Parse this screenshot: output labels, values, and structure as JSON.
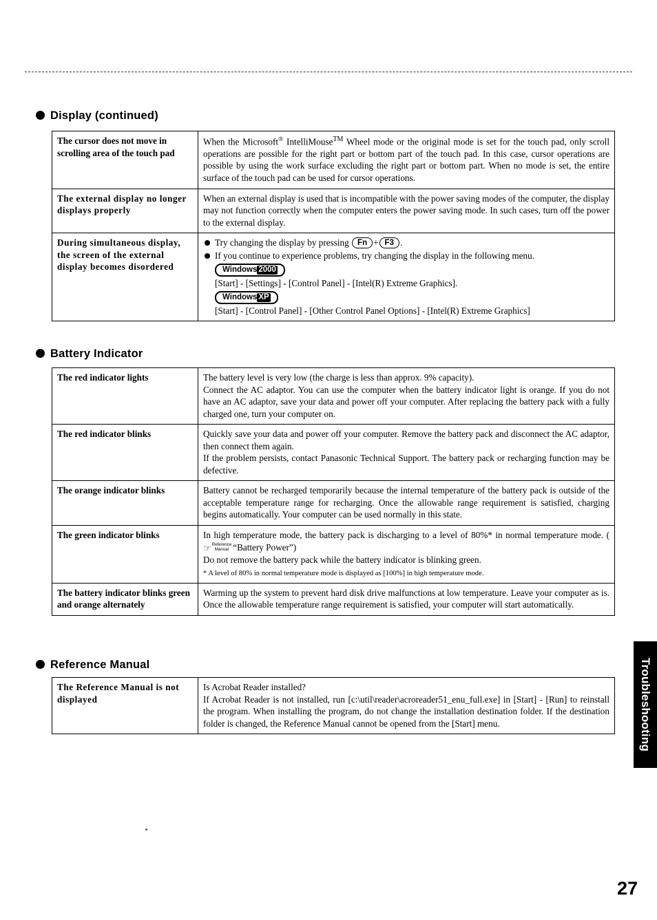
{
  "page": {
    "number": "27",
    "side_tab": "Troubleshooting"
  },
  "sections": [
    {
      "id": "display",
      "heading": "Display (continued)",
      "rows": [
        {
          "label": "The cursor does not move in scrolling area of the touch pad",
          "body": "When the Microsoft® IntelliMouse™ Wheel mode or the original mode is set for the touch pad, only scroll operations are possible for the right part or bottom part of the touch pad. In this case, cursor operations are possible by using the work surface excluding the right part or bottom part. When no mode is set, the entire surface of the touch pad can be used for cursor operations."
        },
        {
          "label": "The external display no longer displays properly",
          "body": "When an external display is used that is incompatible with the power saving modes of the computer, the display may not function correctly when the computer enters the power saving mode. In such cases, turn off the power to the external display."
        },
        {
          "label": "During simultaneous display, the screen of the external display becomes disordered",
          "bullets": [
            "Try changing the display by pressing  Fn + F3 .",
            "If you continue to experience problems, try changing the display in the following menu."
          ],
          "keys": {
            "first": "Fn",
            "second": "F3"
          },
          "badges": [
            {
              "badge_prefix": "Windows",
              "badge_suffix": "2000",
              "path": "[Start] - [Settings] - [Control Panel] - [Intel(R) Extreme Graphics]."
            },
            {
              "badge_prefix": "Windows",
              "badge_suffix": "XP",
              "path": "[Start] - [Control Panel] - [Other Control Panel Options] - [Intel(R) Extreme Graphics]"
            }
          ]
        }
      ]
    },
    {
      "id": "battery",
      "heading": "Battery Indicator",
      "rows": [
        {
          "label": "The red indicator lights",
          "body": "The battery level is very low (the charge is less than approx. 9% capacity).\nConnect the AC adaptor. You can use the computer when the battery indicator light is orange. If you do not have an AC adaptor, save your data and power off your computer. After replacing the battery pack with a fully charged one, turn your computer on."
        },
        {
          "label": "The red indicator blinks",
          "body": "Quickly save your data and power off your computer. Remove the battery pack and disconnect the AC adaptor, then connect them again.\nIf the problem persists, contact Panasonic Technical Support.  The battery pack or recharging function may be defective."
        },
        {
          "label": "The orange indicator blinks",
          "body": "Battery cannot be recharged temporarily because the internal temperature of the battery pack is outside of the acceptable temperature range for recharging. Once the allowable range requirement is satisfied, charging begins automatically. Your computer can be used normally in this state."
        },
        {
          "label": "The green indicator blinks",
          "body_line1": "In high temperature mode, the battery pack is discharging to a level of 80%* in normal temperature mode. (",
          "ref_label_line1": "Reference",
          "ref_label_line2": "Manual",
          "body_line1_cont": "“Battery Power”)",
          "body_line2": "Do not remove the battery pack while the battery indicator is blinking green.",
          "footnote": "* A level of 80% in normal temperature mode is displayed as [100%] in high temperature mode."
        },
        {
          "label": "The battery indicator blinks green and orange alternately",
          "body": "Warming up the system to prevent hard disk drive malfunctions at low temperature.  Leave your computer as is. Once the allowable temperature range requirement is satisfied, your computer will start automatically."
        }
      ]
    },
    {
      "id": "reference-manual",
      "heading": "Reference Manual",
      "rows": [
        {
          "label": "The Reference Manual is not displayed",
          "body": "Is Acrobat Reader installed?\nIf Acrobat Reader is not installed, run [c:\\util\\reader\\acroreader51_enu_full.exe] in [Start] - [Run] to reinstall the program.  When installing the program, do not change the installation destination folder.  If the destination folder is changed, the Reference Manual cannot be opened from the [Start] menu."
        }
      ]
    }
  ]
}
